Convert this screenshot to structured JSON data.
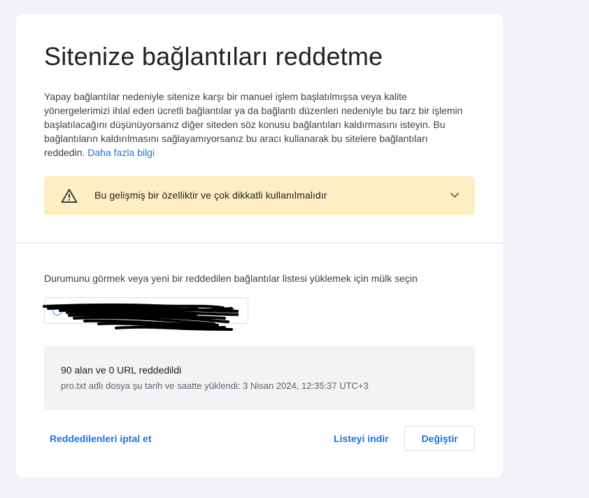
{
  "page": {
    "title": "Sitenize bağlantıları reddetme",
    "description": "Yapay bağlantılar nedeniyle sitenize karşı bir manuel işlem başlatılmışsa veya kalite yönergelerimizi ihlal eden ücretli bağlantılar ya da bağlantı düzenleri nedeniyle bu tarz bir işlemin başlatılacağını düşünüyorsanız diğer siteden söz konusu bağlantıları kaldırmasını isteyin. Bu bağlantıların kaldırılmasını sağlayamıyorsanız bu aracı kullanarak bu sitelere bağlantıları reddedin.",
    "learn_more": "Daha fazla bilgi"
  },
  "warning": {
    "text": "Bu gelişmiş bir özelliktir ve çok dikkatli kullanılmalıdır",
    "icon": "warning-icon",
    "expand_icon": "chevron-down-icon"
  },
  "property": {
    "label": "Durumunu görmek veya yeni bir reddedilen bağlantılar listesi yüklemek için mülk seçin",
    "selected_value": ""
  },
  "status": {
    "summary": "90 alan ve 0 URL reddedildi",
    "detail": "pro.txt adlı dosya şu tarih ve saatte yüklendi: 3 Nisan 2024, 12:35:37 UTC+3"
  },
  "actions": {
    "cancel_label": "Reddedilenleri iptal et",
    "download_label": "Listeyi indir",
    "change_label": "Değiştir"
  },
  "colors": {
    "accent": "#1a73e8",
    "warning_bg": "#fdefc3",
    "page_bg": "#f1f3f8",
    "status_bg": "#f1f3f4"
  }
}
